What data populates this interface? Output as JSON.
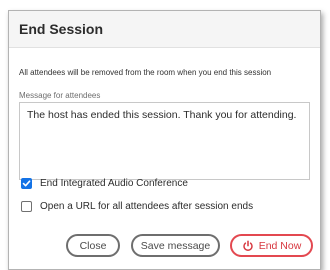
{
  "dialog": {
    "title": "End Session",
    "info": "All attendees will be removed from the room when you end this session",
    "message_label": "Message for attendees",
    "message_value": "The host has ended this session. Thank you for attending."
  },
  "options": [
    {
      "label": "End Integrated Audio Conference",
      "checked": true
    },
    {
      "label": "Open a URL for all attendees after session ends",
      "checked": false
    }
  ],
  "buttons": {
    "close": "Close",
    "save": "Save message",
    "end": "End Now"
  },
  "icons": {
    "checkmark": "checkmark-icon",
    "end": "power-icon"
  },
  "colors": {
    "accent": "#1473e6",
    "danger": "#e34850"
  }
}
